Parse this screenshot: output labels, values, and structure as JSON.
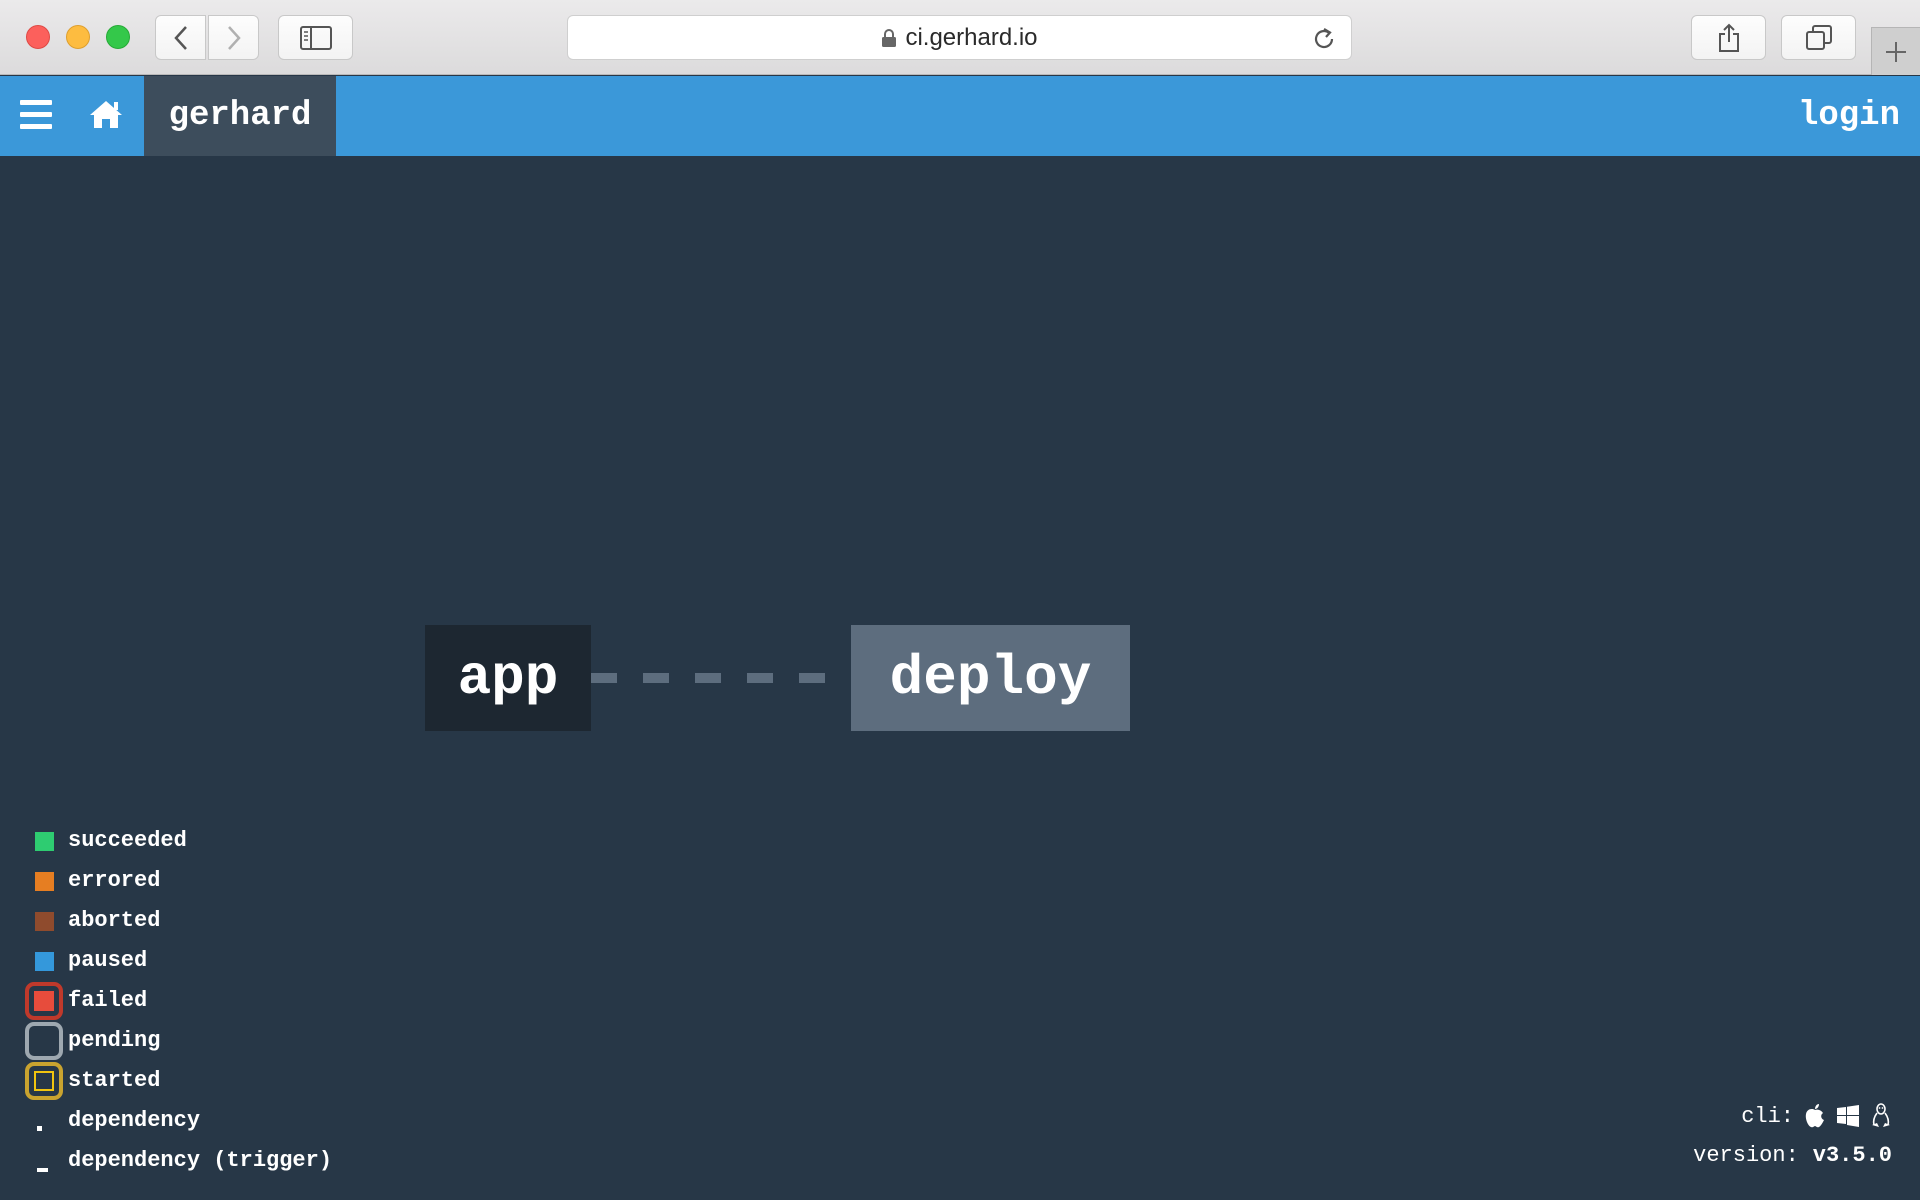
{
  "browser": {
    "url": "ci.gerhard.io"
  },
  "topbar": {
    "pipeline_name": "gerhard",
    "login_label": "login"
  },
  "pipeline": {
    "jobs": [
      {
        "name": "app",
        "color": "#1d2731"
      },
      {
        "name": "deploy",
        "color": "#5d6d7e"
      }
    ],
    "edge_style": "dashed"
  },
  "legend": {
    "items": [
      {
        "label": "succeeded",
        "color": "#2ecc71"
      },
      {
        "label": "errored",
        "color": "#e67e22"
      },
      {
        "label": "aborted",
        "color": "#8f4b2d"
      },
      {
        "label": "paused",
        "color": "#3498db"
      },
      {
        "label": "failed",
        "color": "#e74c3c"
      },
      {
        "label": "pending",
        "color": "#9ea8b0"
      },
      {
        "label": "started",
        "color": "#f1c40f"
      },
      {
        "label": "dependency"
      },
      {
        "label": "dependency (trigger)"
      }
    ]
  },
  "footer": {
    "cli_label": "cli:",
    "cli_icons": [
      "apple-icon",
      "windows-icon",
      "linux-icon"
    ],
    "version_label": "version:",
    "version_value": "v3.5.0"
  }
}
